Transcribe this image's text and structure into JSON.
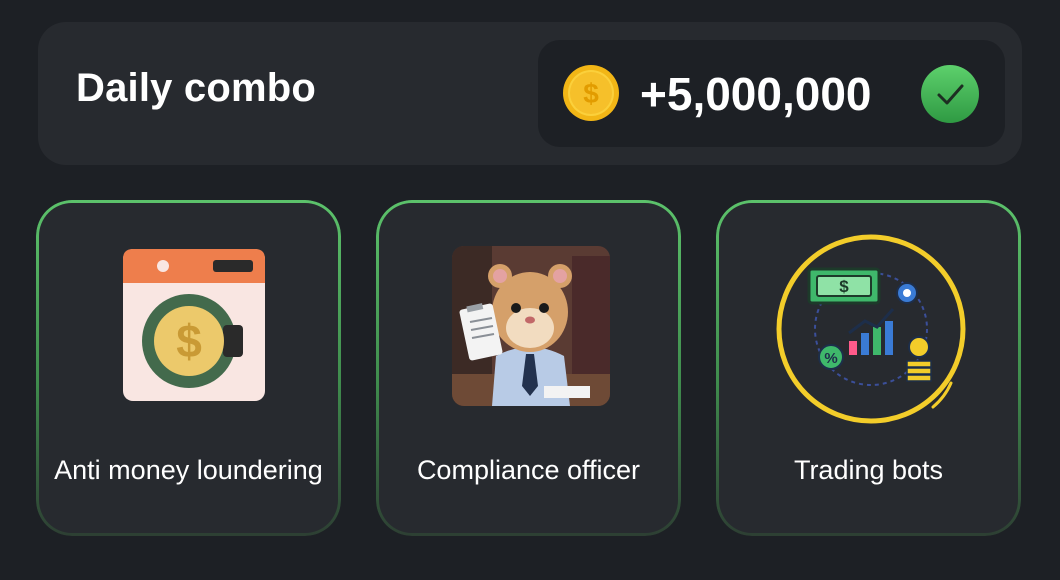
{
  "combo": {
    "title": "Daily combo",
    "reward": "+5,000,000",
    "coin_symbol": "$",
    "completed": true
  },
  "cards": [
    {
      "label": "Anti money loundering",
      "icon": "washing-machine-coin-icon"
    },
    {
      "label": "Compliance officer",
      "icon": "hamster-officer-image"
    },
    {
      "label": "Trading bots",
      "icon": "trading-bots-icon"
    }
  ],
  "colors": {
    "background": "#1d2025",
    "panel": "#272a2f",
    "accent_green": "#5cc26b",
    "coin_gold": "#f7c531",
    "check_green": "#3fb950"
  }
}
